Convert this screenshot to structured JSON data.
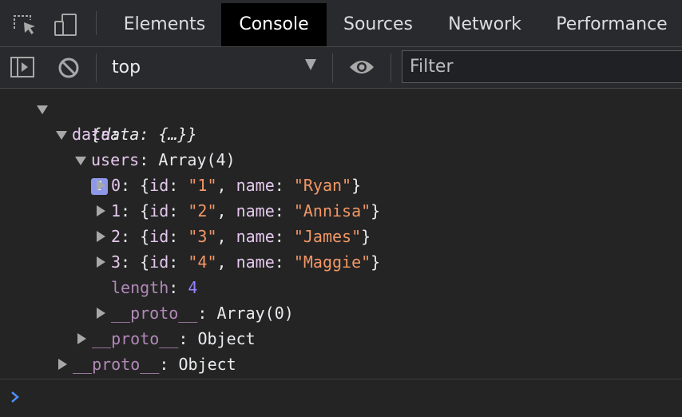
{
  "tabs": [
    {
      "label": "Elements"
    },
    {
      "label": "Console"
    },
    {
      "label": "Sources"
    },
    {
      "label": "Network"
    },
    {
      "label": "Performance"
    }
  ],
  "toolbar": {
    "context": "top",
    "filter_placeholder": "Filter"
  },
  "console": {
    "root_summary": "{data: {…}}",
    "data_key": "data",
    "users_key": "users",
    "users_value": "Array(4)",
    "items": [
      {
        "index": "0",
        "id": "\"1\"",
        "name": "\"Ryan\""
      },
      {
        "index": "1",
        "id": "\"2\"",
        "name": "\"Annisa\""
      },
      {
        "index": "2",
        "id": "\"3\"",
        "name": "\"James\""
      },
      {
        "index": "3",
        "id": "\"4\"",
        "name": "\"Maggie\""
      }
    ],
    "length_key": "length",
    "length_value": "4",
    "proto_key": "__proto__",
    "array_proto_value": "Array(0)",
    "object_proto_value": "Object",
    "id_key": "id",
    "name_key": "name"
  },
  "colors": {
    "background": "#242424",
    "key": "#e5c7ee",
    "string": "#f29766",
    "number": "#9980ff",
    "active_tab": "#000000",
    "info_badge": "#8d98e8",
    "prompt": "#4d8ff5"
  },
  "icons": [
    "inspect-element-icon",
    "device-toolbar-icon",
    "sidebar-toggle-icon",
    "clear-console-icon",
    "eye-icon",
    "info-icon",
    "prompt-chevron-icon"
  ]
}
